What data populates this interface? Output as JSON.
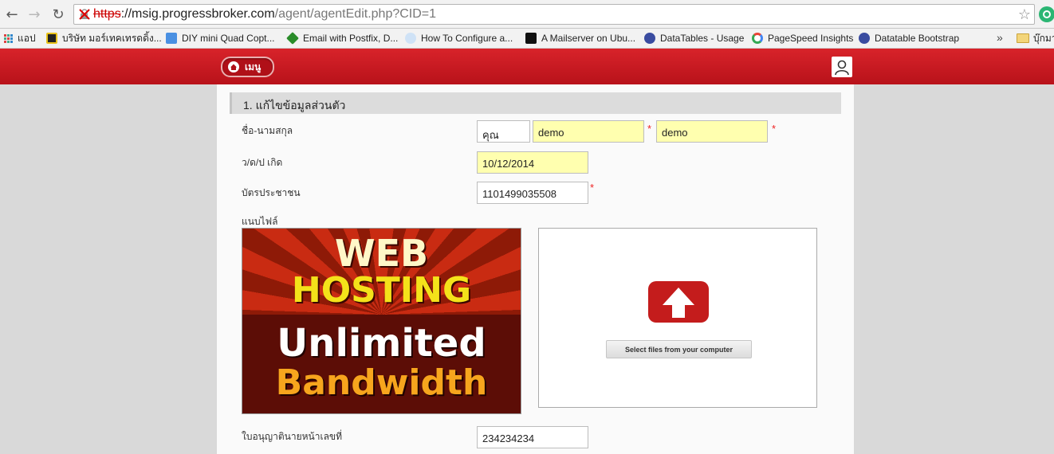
{
  "browser": {
    "url": {
      "scheme": "https",
      "separator": "://",
      "host": "msig.progressbroker.com",
      "path": "/agent/agentEdit.php?CID=1"
    },
    "bookmarks": [
      "แอป",
      "บริษัท มอร์เทคเทรดดิ้ง...",
      "DIY mini Quad Copt...",
      "Email with Postfix, D...",
      "How To Configure a...",
      "A Mailserver on Ubu...",
      "DataTables - Usage",
      "PageSpeed Insights",
      "Datatable Bootstrap"
    ],
    "more_bookmarks": "»",
    "other_bookmarks": "บุ๊กมา"
  },
  "header": {
    "menu_label": "เมนู"
  },
  "form": {
    "section_title": "1. แก้ไขข้อมูลส่วนตัว",
    "name_label": "ชื่อ-นามสกุล",
    "title_value": "คุณ",
    "first_name_value": "demo",
    "last_name_value": "demo",
    "dob_label": "ว/ด/ป เกิด",
    "dob_value": "10/12/2014",
    "id_card_label": "บัตรประชาชน",
    "id_card_value": "1101499035508",
    "attach_label": "แนบไฟล์",
    "license_label": "ใบอนุญาตินายหน้าเลขที่",
    "license_value": "234234234",
    "required_mark": "*"
  },
  "ad_image": {
    "line1": "WEB",
    "line2": "HOSTING",
    "line3": "Unlimited",
    "line4": "Bandwidth"
  },
  "upload": {
    "button_label": "Select files from your computer"
  },
  "colors": {
    "header_red": "#c81a21",
    "field_yellow": "#ffffaf",
    "required_red": "#e22222"
  }
}
